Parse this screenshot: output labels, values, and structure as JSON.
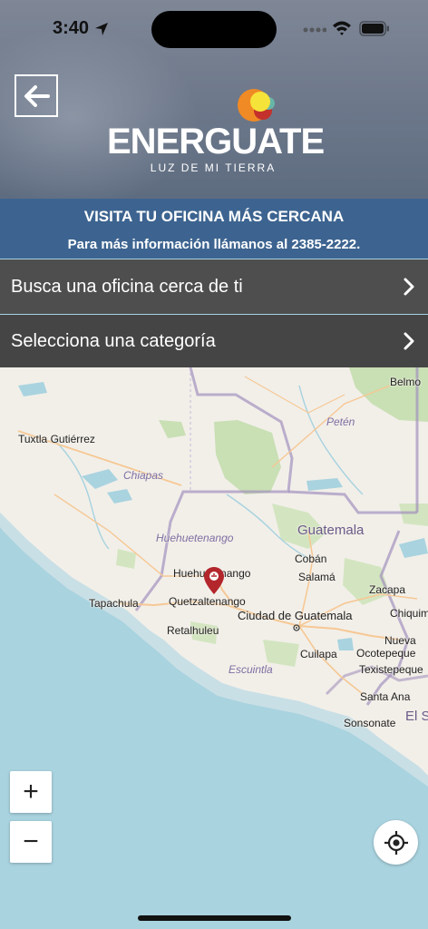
{
  "status_bar": {
    "time": "3:40"
  },
  "header": {
    "brand_name": "ENERGUATE",
    "brand_tagline": "LUZ DE MI TIERRA"
  },
  "banner": {
    "title": "VISITA TU OFICINA MÁS CERCANA",
    "subtitle": "Para más información llámanos al 2385-2222."
  },
  "menu": {
    "items": [
      {
        "label": "Busca una oficina cerca de ti"
      },
      {
        "label": "Selecciona una categoría"
      }
    ]
  },
  "map": {
    "labels": {
      "belmopan": "Belmo",
      "peten": "Petén",
      "tuxtla": "Tuxtla Gutiérrez",
      "chiapas": "Chiapas",
      "guatemala_country": "Guatemala",
      "huehuetenango_dept": "Huehuetenango",
      "coban": "Cobán",
      "huehuetenango_city": "Huehuetenango",
      "salama": "Salamá",
      "zacapa": "Zacapa",
      "tapachula": "Tapachula",
      "quetzaltenango": "Quetzaltenango",
      "chiquimula": "Chiquim",
      "retalhuleu": "Retalhuleu",
      "ciudad": "Ciudad de Guatemala",
      "nueva": "Nueva",
      "ocotepeque": "Ocotepeque",
      "cuilapa": "Cuilapa",
      "escuintla": "Escuintla",
      "texistepeque": "Texistepeque",
      "santa_ana": "Santa Ana",
      "el_salvador": "El S",
      "sonsonate": "Sonsonate"
    },
    "zoom_in": "+",
    "zoom_out": "−"
  },
  "colors": {
    "banner": "#3d6490",
    "menu_row": "#4e4e4e",
    "pin": "#b3262c",
    "water": "#a9d3df",
    "land": "#f2efe9"
  }
}
